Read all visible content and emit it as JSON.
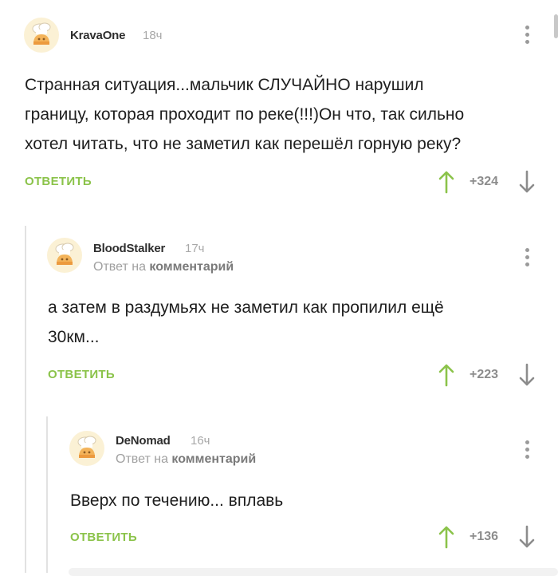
{
  "comments": [
    {
      "username": "KravaOne",
      "time": "18ч",
      "avatar_icon": "default-avatar-icon",
      "lines": [
        "Странная ситуация...мальчик СЛУЧАЙНО нарушил",
        "границу, которая проходит по реке(!!!)Он что, так сильно",
        "хотел читать, что не заметил как перешёл горную реку?"
      ],
      "reply_label": "ОТВЕТИТЬ",
      "score": "+324"
    },
    {
      "username": "BloodStalker",
      "time": "17ч",
      "avatar_icon": "default-avatar-icon",
      "reply_to_prefix": "Ответ на",
      "reply_to_target": "комментарий",
      "lines": [
        "а затем в раздумьях не заметил как пропилил ещё",
        "30км..."
      ],
      "reply_label": "ОТВЕТИТЬ",
      "score": "+223"
    },
    {
      "username": "DeNomad",
      "time": "16ч",
      "avatar_icon": "default-avatar-icon",
      "reply_to_prefix": "Ответ на",
      "reply_to_target": "комментарий",
      "lines": [
        "Вверх по течению... вплавь"
      ],
      "reply_label": "ОТВЕТИТЬ",
      "score": "+136"
    }
  ],
  "colors": {
    "accent_green": "#8bc34a",
    "thread_line": "#e2e2e2",
    "muted_text": "#a0a0a0"
  },
  "icons": {
    "more": "more-vertical-icon",
    "upvote": "arrow-up-icon",
    "downvote": "arrow-down-icon"
  }
}
